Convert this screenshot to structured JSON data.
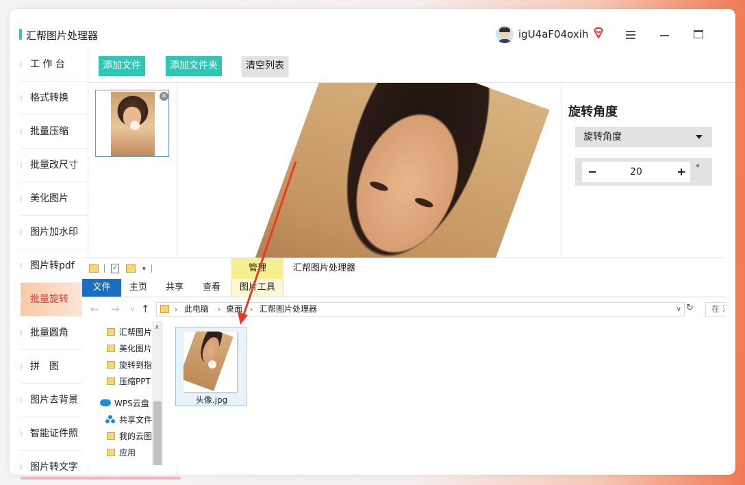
{
  "app": {
    "title": "汇帮图片处理器",
    "username": "igU4aF04oxih"
  },
  "sidebar": {
    "items": [
      {
        "label": "工 作 台"
      },
      {
        "label": "格式转换"
      },
      {
        "label": "批量压缩"
      },
      {
        "label": "批量改尺寸"
      },
      {
        "label": "美化图片"
      },
      {
        "label": "图片加水印"
      },
      {
        "label": "图片转pdf"
      },
      {
        "label": "批量旋转",
        "active": true
      },
      {
        "label": "批量圆角"
      },
      {
        "label": "拼　图"
      },
      {
        "label": "图片去背景"
      },
      {
        "label": "智能证件照"
      },
      {
        "label": "图片转文字"
      }
    ]
  },
  "toolbar": {
    "add_file": "添加文件",
    "add_folder": "添加文件夹",
    "clear_list": "清空列表"
  },
  "settings": {
    "title": "旋转角度",
    "dropdown_value": "旋转角度",
    "angle_value": "20",
    "unit": "°"
  },
  "explorer": {
    "manage_tab": "管理",
    "window_title": "汇帮图片处理器",
    "ribbon_tabs": [
      "文件",
      "主页",
      "共享",
      "查看",
      "图片工具"
    ],
    "breadcrumb": [
      "此电脑",
      "桌面",
      "汇帮图片处理器"
    ],
    "search_placeholder": "在 汇",
    "nav_items": [
      "汇帮图片",
      "美化图片",
      "旋转到指",
      "压缩PPT",
      "WPS云盘",
      "共享文件",
      "我的云图",
      "应用"
    ],
    "file_name": "头像.jpg"
  },
  "colors": {
    "accent_teal": "#2ec6b4",
    "active_red": "#e53935",
    "file_tab_blue": "#1b6ec2",
    "manage_yellow": "#f6ef8f",
    "arrow_red": "#e8392a"
  }
}
